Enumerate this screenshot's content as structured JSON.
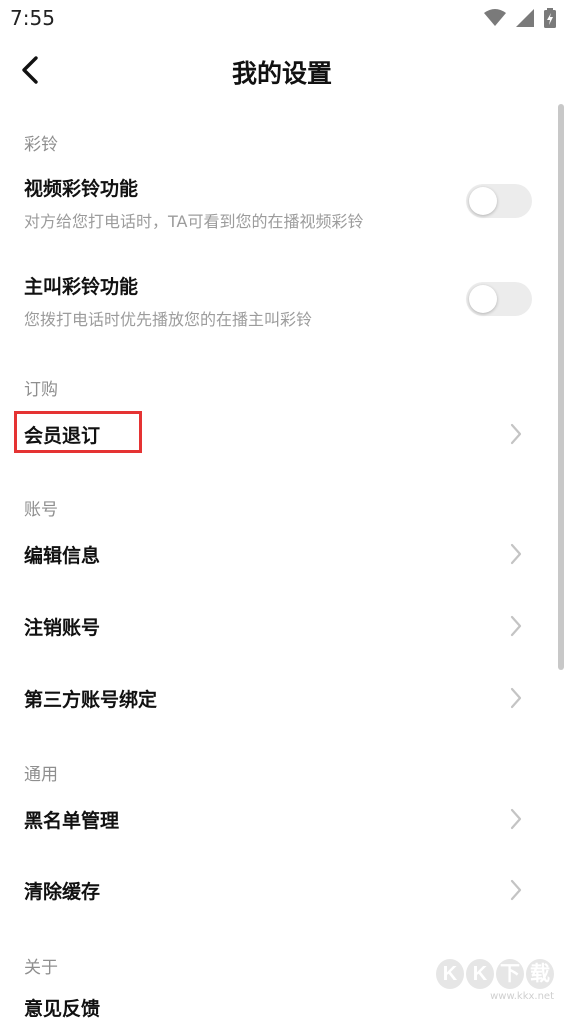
{
  "status_bar": {
    "time": "7:55"
  },
  "header": {
    "title": "我的设置"
  },
  "sections": {
    "ringtone": {
      "label": "彩铃",
      "video": {
        "title": "视频彩铃功能",
        "subtitle": "对方给您打电话时，TA可看到您的在播视频彩铃",
        "enabled": false
      },
      "caller": {
        "title": "主叫彩铃功能",
        "subtitle": "您拨打电话时优先播放您的在播主叫彩铃",
        "enabled": false
      }
    },
    "order": {
      "label": "订购",
      "unsubscribe": "会员退订"
    },
    "account": {
      "label": "账号",
      "edit_info": "编辑信息",
      "cancel_account": "注销账号",
      "third_party": "第三方账号绑定"
    },
    "general": {
      "label": "通用",
      "blacklist": "黑名单管理",
      "clear_cache": "清除缓存"
    },
    "about": {
      "label": "关于",
      "partial_item": "意见反馈"
    }
  },
  "watermark": {
    "logo": [
      "K",
      "K",
      "下",
      "载"
    ],
    "url": "www.kkx.net"
  },
  "colors": {
    "highlight": "#e53333",
    "toggle_off": "#ececec",
    "section_label": "#8f8f8f"
  }
}
